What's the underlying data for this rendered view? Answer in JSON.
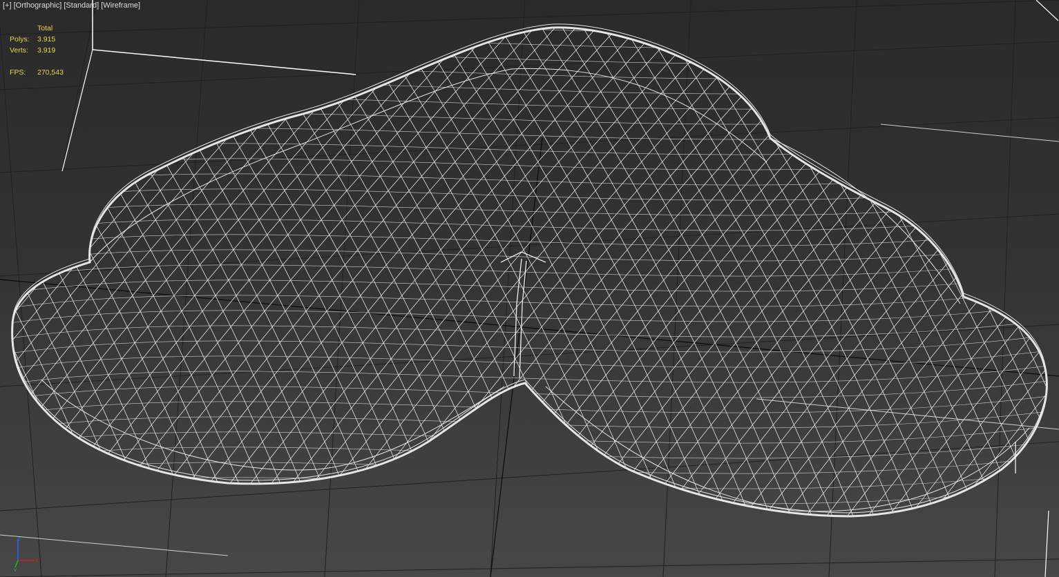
{
  "viewport": {
    "label_parts": [
      "[+]",
      "[Orthographic]",
      "[Standard]",
      "[Wireframe]"
    ],
    "view_type": "Orthographic",
    "shading": "Wireframe"
  },
  "stats": {
    "header": "Total",
    "polys_label": "Polys:",
    "polys_value": "3.915",
    "verts_label": "Verts:",
    "verts_value": "3.919",
    "fps_label": "FPS:",
    "fps_value": "270,543"
  },
  "colors": {
    "background_top": "#2a2a2a",
    "background_bottom": "#474747",
    "grid": "#202020",
    "grid_major": "#0a0a0a",
    "wire": "#e6e6e6",
    "stats_text": "#e8d84a",
    "label_text": "#dcdcdc",
    "bracket": "#ffffff",
    "axis_x": "#d02020",
    "axis_y": "#20c020",
    "axis_z": "#3060ff"
  },
  "axis_gizmo": {
    "x": "x",
    "y": "y",
    "z": "z"
  }
}
